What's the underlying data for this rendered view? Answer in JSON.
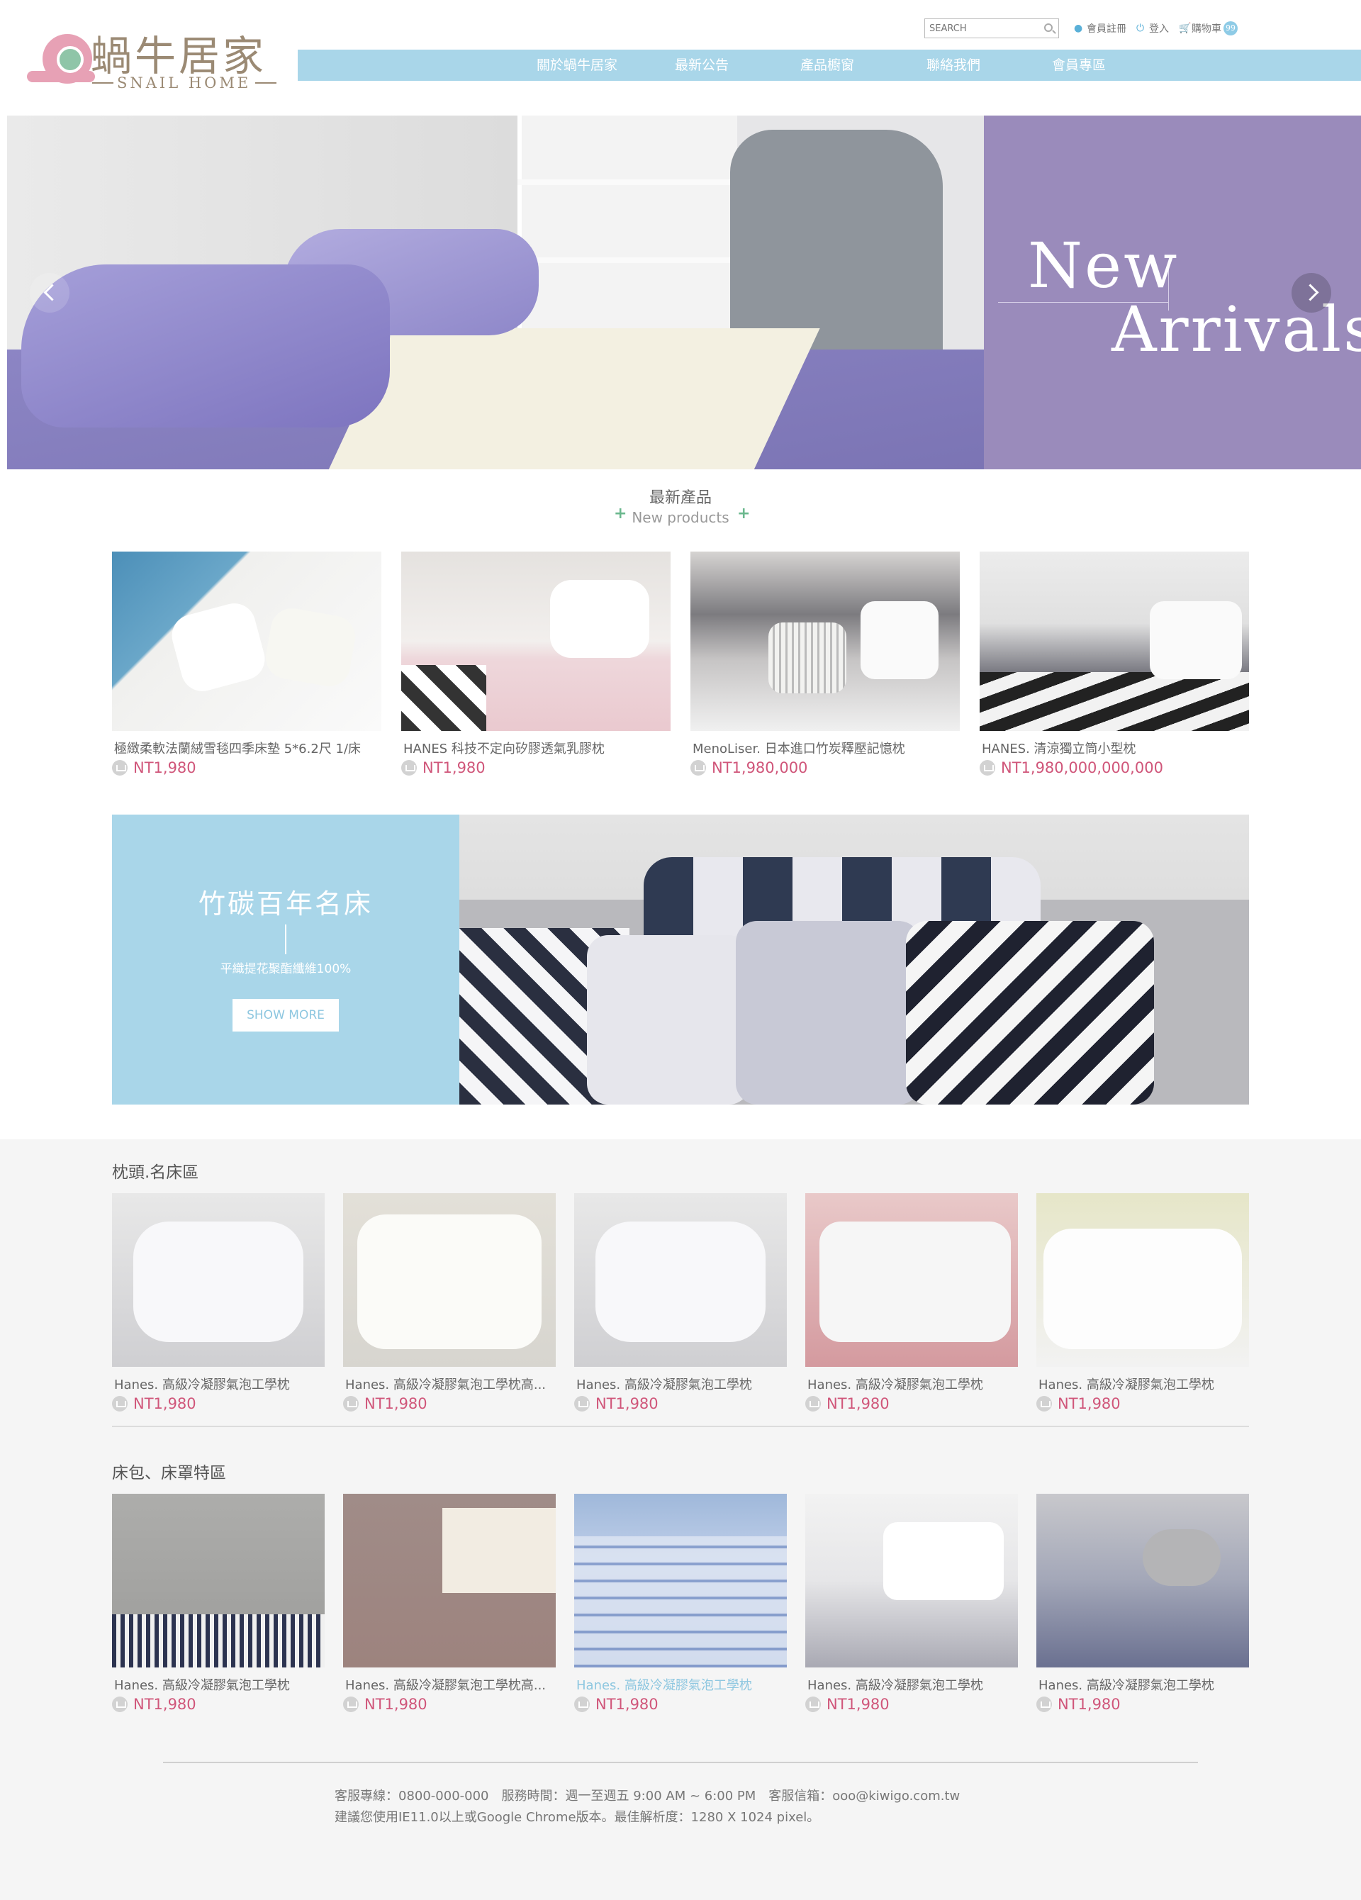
{
  "header": {
    "logo_cn": "蝸牛居家",
    "logo_en": "SNAIL HOME",
    "search_placeholder": "SEARCH",
    "links": {
      "register": "會員註冊",
      "login": "登入",
      "cart": "購物車",
      "cart_count": "99"
    },
    "nav": [
      "關於蝸牛居家",
      "最新公告",
      "產品櫥窗",
      "聯絡我們",
      "會員專區"
    ]
  },
  "hero": {
    "line1": "New",
    "line2": "Arrivals"
  },
  "new_products": {
    "title_zh": "最新產品",
    "title_en": "New products",
    "items": [
      {
        "name": "極緻柔軟法蘭絨雪毯四季床墊 5*6.2尺 1/床",
        "price": "NT1,980"
      },
      {
        "name": "HANES 科技不定向矽膠透氣乳膠枕",
        "price": "NT1,980"
      },
      {
        "name": "MenoLiser. 日本進口竹炭釋壓記憶枕",
        "price": "NT1,980,000"
      },
      {
        "name": "HANES. 清涼獨立筒小型枕",
        "price": "NT1,980,000,000,000"
      }
    ]
  },
  "banner": {
    "heading": "竹碳百年名床",
    "sub": "平織提花聚酯纖維100%",
    "button": "SHOW MORE"
  },
  "pillow_section": {
    "title": "枕頭.名床區",
    "items": [
      {
        "name": "Hanes. 高級冷凝膠氣泡工學枕",
        "price": "NT1,980"
      },
      {
        "name": "Hanes. 高級冷凝膠氣泡工學枕高...",
        "price": "NT1,980"
      },
      {
        "name": "Hanes. 高級冷凝膠氣泡工學枕",
        "price": "NT1,980"
      },
      {
        "name": "Hanes. 高級冷凝膠氣泡工學枕",
        "price": "NT1,980"
      },
      {
        "name": "Hanes. 高級冷凝膠氣泡工學枕",
        "price": "NT1,980"
      }
    ]
  },
  "bedding_section": {
    "title": "床包、床罩特區",
    "items": [
      {
        "name": "Hanes. 高級冷凝膠氣泡工學枕",
        "price": "NT1,980"
      },
      {
        "name": "Hanes. 高級冷凝膠氣泡工學枕高...",
        "price": "NT1,980"
      },
      {
        "name": "Hanes. 高級冷凝膠氣泡工學枕",
        "price": "NT1,980"
      },
      {
        "name": "Hanes. 高級冷凝膠氣泡工學枕",
        "price": "NT1,980"
      },
      {
        "name": "Hanes. 高級冷凝膠氣泡工學枕",
        "price": "NT1,980"
      }
    ]
  },
  "footer": {
    "line1": "客服專線：0800-000-000　服務時間：週一至週五 9:00 AM ~ 6:00 PM　客服信箱：ooo@kiwigo.com.tw",
    "line2": "建議您使用IE11.0以上或Google Chrome版本。最佳解析度：1280 X 1024 pixel。"
  },
  "colors": {
    "accent_blue": "#a9d6e9",
    "price_pink": "#d0567a",
    "promo_purple": "#9a8bbb",
    "hover_blue": "#8ec7e0"
  }
}
